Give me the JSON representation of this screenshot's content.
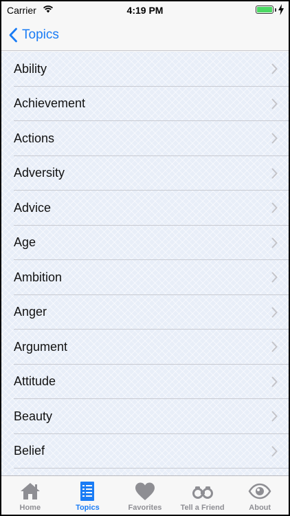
{
  "status_bar": {
    "carrier": "Carrier",
    "time": "4:19 PM",
    "battery_level": 1.0
  },
  "nav": {
    "back_label": "Topics"
  },
  "topics": [
    {
      "label": "Ability"
    },
    {
      "label": "Achievement"
    },
    {
      "label": "Actions"
    },
    {
      "label": "Adversity"
    },
    {
      "label": "Advice"
    },
    {
      "label": "Age"
    },
    {
      "label": "Ambition"
    },
    {
      "label": "Anger"
    },
    {
      "label": "Argument"
    },
    {
      "label": "Attitude"
    },
    {
      "label": "Beauty"
    },
    {
      "label": "Belief"
    }
  ],
  "tabs": [
    {
      "label": "Home",
      "icon": "home-icon",
      "active": false
    },
    {
      "label": "Topics",
      "icon": "document-list-icon",
      "active": true
    },
    {
      "label": "Favorites",
      "icon": "heart-icon",
      "active": false
    },
    {
      "label": "Tell a Friend",
      "icon": "binoculars-icon",
      "active": false
    },
    {
      "label": "About",
      "icon": "eye-icon",
      "active": false
    }
  ],
  "colors": {
    "accent": "#1a7cf5",
    "tab_inactive": "#8e8e93",
    "list_background": "#e8eef8"
  }
}
